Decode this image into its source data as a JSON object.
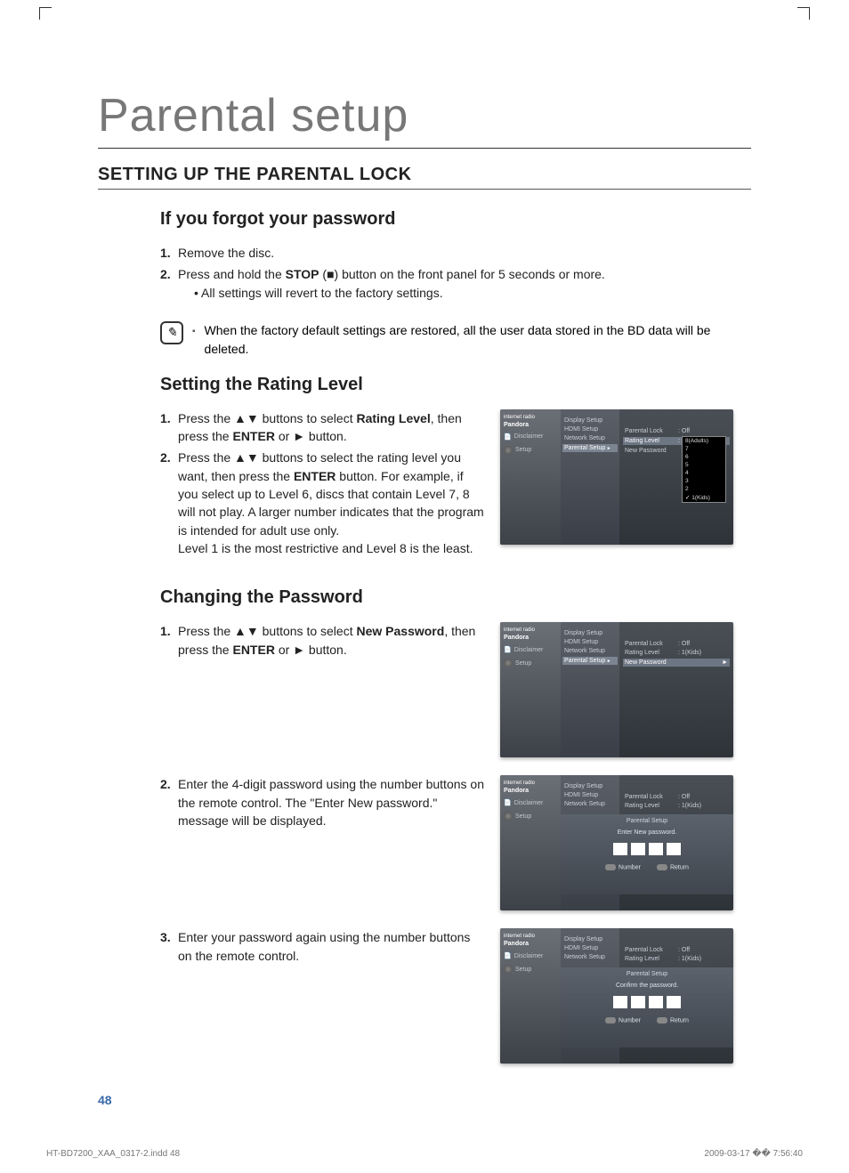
{
  "page": {
    "title": "Parental setup",
    "section_heading": "SETTING UP THE PARENTAL LOCK",
    "page_number": "48"
  },
  "forgot": {
    "heading": "If you forgot your password",
    "step1_num": "1.",
    "step1_text": "Remove the disc.",
    "step2_num": "2.",
    "step2_pre": "Press and hold the ",
    "step2_bold": "STOP",
    "step2_post": " (■) button on the front panel for 5 seconds or more.",
    "step2_bullet": "All settings will revert to the factory settings.",
    "note": "When the factory default settings are restored, all the user data stored in the BD data will be deleted."
  },
  "rating": {
    "heading": "Setting the Rating Level",
    "step1_num": "1.",
    "step1_a": "Press the ▲▼ buttons to select ",
    "step1_bold": "Rating Level",
    "step1_b": ", then press the ",
    "step1_bold2": "ENTER",
    "step1_c": " or ► button.",
    "step2_num": "2.",
    "step2_a": "Press the ▲▼ buttons to select the rating level you want, then press the ",
    "step2_bold": "ENTER",
    "step2_b": " button. For example, if you select up to Level 6, discs that contain Level 7, 8 will not play. A larger number indicates that the program is intended for adult use only.",
    "step2_line2": "Level 1 is the most restrictive and Level 8 is the least."
  },
  "pwd": {
    "heading": "Changing the Password",
    "step1_num": "1.",
    "step1_a": "Press the ▲▼ buttons to select ",
    "step1_bold": "New Password",
    "step1_b": ", then press the ",
    "step1_bold2": "ENTER",
    "step1_c": " or ► button.",
    "step2_num": "2.",
    "step2_text": "Enter the 4-digit password using the number buttons on the remote control. The \"Enter New password.\" message will be displayed.",
    "step3_num": "3.",
    "step3_text": "Enter your password again using the number buttons on the remote control."
  },
  "screens": {
    "side": {
      "brand": "internet radio",
      "pandora": "Pandora",
      "disclaimer": "Disclaimer",
      "setup": "Setup"
    },
    "mid": {
      "display": "Display Setup",
      "hdmi": "HDMI Setup",
      "network": "Network Setup",
      "parental": "Parental Setup"
    },
    "right": {
      "parental_lock_k": "Parental Lock",
      "parental_lock_v": "Off",
      "rating_level_k": "Rating Level",
      "rating_level_v": "1(Kids)",
      "new_password_k": "New Password"
    },
    "dropdown": {
      "o8": "8(Adults)",
      "o7": "7",
      "o6": "6",
      "o5": "5",
      "o4": "4",
      "o3": "3",
      "o2": "2",
      "o1": "1(Kids)"
    },
    "overlay": {
      "title": "Parental Setup",
      "enter_msg": "Enter New password.",
      "confirm_msg": "Confirm the password.",
      "btn_number": "Number",
      "btn_return": "Return"
    }
  },
  "footer": {
    "left": "HT-BD7200_XAA_0317-2.indd   48",
    "right": "2009-03-17   �� 7:56:40"
  }
}
